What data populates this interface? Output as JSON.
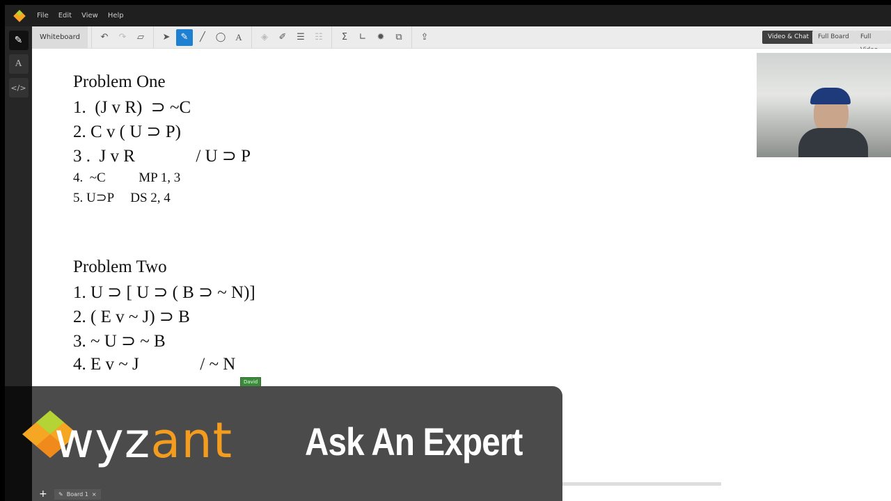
{
  "menu": [
    "File",
    "Edit",
    "View",
    "Help"
  ],
  "toolbar": {
    "label": "Whiteboard",
    "view_buttons": [
      "Video & Chat",
      "Full Board",
      "Full Video"
    ]
  },
  "problem_one": {
    "title": "Problem One",
    "lines": [
      "1.  (J v R)  ⊃ ~C",
      "2. C v ( U ⊃ P)",
      "3 .  J v R              / U ⊃ P",
      "4.  ~C          MP 1, 3",
      "5. U⊃P     DS 2, 4"
    ]
  },
  "problem_two": {
    "title": "Problem Two",
    "lines": [
      "1. U ⊃ [ U ⊃ ( B ⊃ ~ N)]",
      "2. ( E v ~ J) ⊃ B",
      "3. ~ U ⊃ ~ B",
      "4. E v ~ J              / ~ N"
    ]
  },
  "cursor_label": "David",
  "brand": {
    "logo_text": "wyzant",
    "tagline": "Ask An Expert",
    "accent": "#f39c1d"
  },
  "tabs": {
    "add": "+",
    "board": "Board 1",
    "close": "×"
  }
}
